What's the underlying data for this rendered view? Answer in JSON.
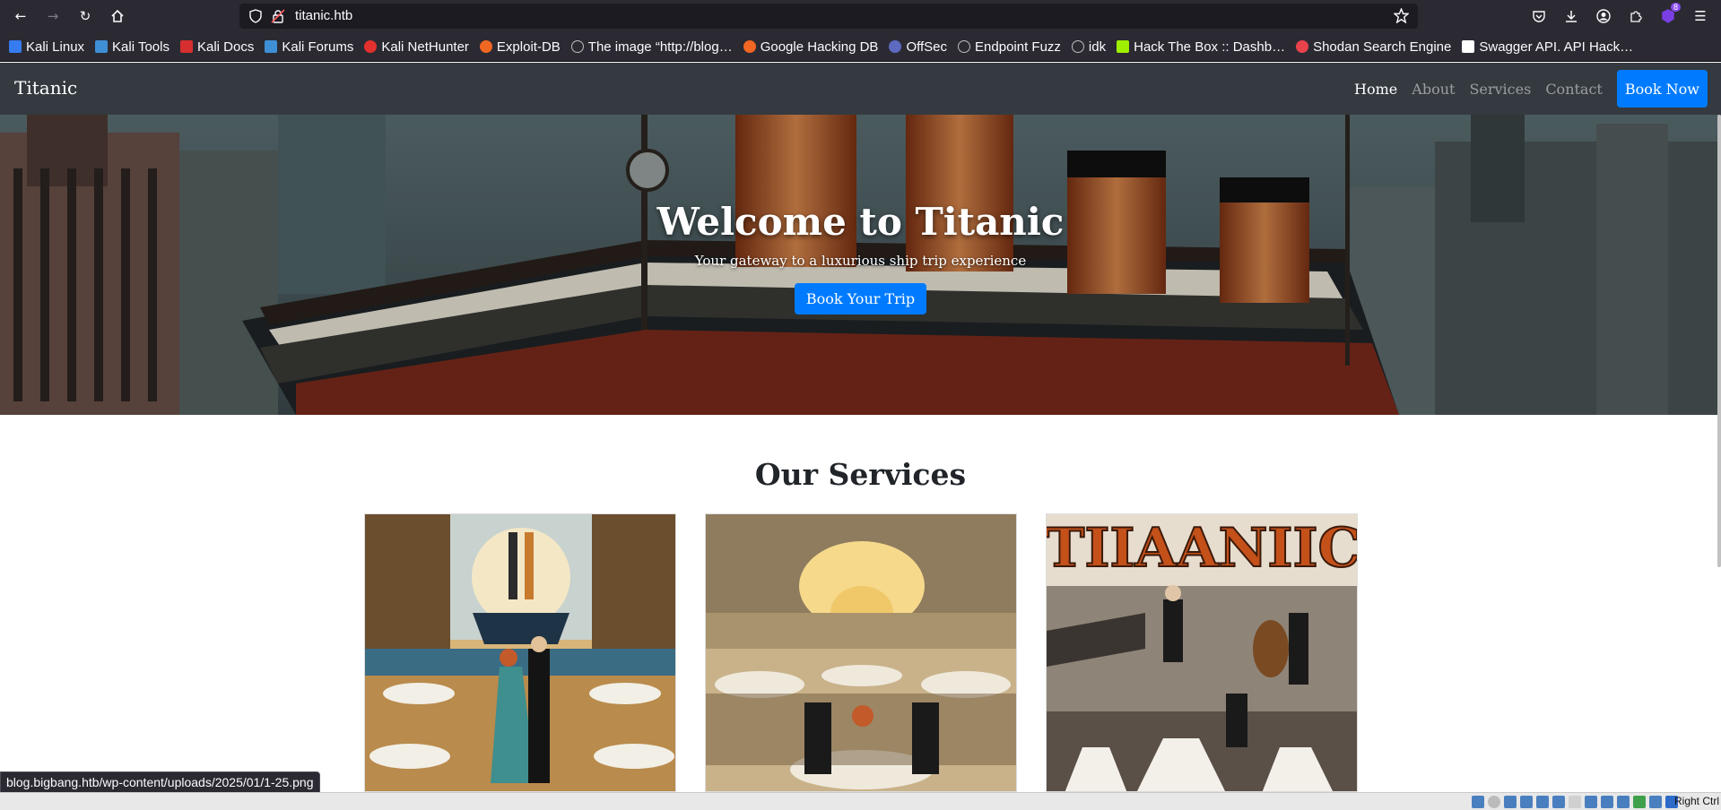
{
  "browser": {
    "url": "titanic.htb",
    "extensions_badge": "8",
    "status_url": "blog.bigbang.htb/wp-content/uploads/2025/01/1-25.png",
    "bookmarks": [
      {
        "label": "Kali Linux",
        "color": "#367bf0"
      },
      {
        "label": "Kali Tools",
        "color": "#3f8fd6"
      },
      {
        "label": "Kali Docs",
        "color": "#d62f2f"
      },
      {
        "label": "Kali Forums",
        "color": "#3f8fd6"
      },
      {
        "label": "Kali NetHunter",
        "color": "#e3312d"
      },
      {
        "label": "Exploit-DB",
        "color": "#f26722"
      },
      {
        "label": "The image “http://blog…",
        "color": "#bdbdbd"
      },
      {
        "label": "Google Hacking DB",
        "color": "#f26722"
      },
      {
        "label": "OffSec",
        "color": "#5c6bc0"
      },
      {
        "label": "Endpoint Fuzz",
        "color": "#bdbdbd"
      },
      {
        "label": "idk",
        "color": "#bdbdbd"
      },
      {
        "label": "Hack The Box :: Dashb…",
        "color": "#9fef00"
      },
      {
        "label": "Shodan Search Engine",
        "color": "#e8434b"
      },
      {
        "label": "Swagger API. API Hack…",
        "color": "#ffffff"
      }
    ]
  },
  "site": {
    "brand": "Titanic",
    "nav": [
      "Home",
      "About",
      "Services",
      "Contact"
    ],
    "book_now": "Book Now",
    "hero": {
      "title": "Welcome to Titanic",
      "subtitle": "Your gateway to a luxurious ship trip experience",
      "cta": "Book Your Trip"
    },
    "services_title": "Our Services",
    "poster_text": "TIIAANIIC"
  },
  "vm": {
    "host_key": "Right Ctrl"
  }
}
